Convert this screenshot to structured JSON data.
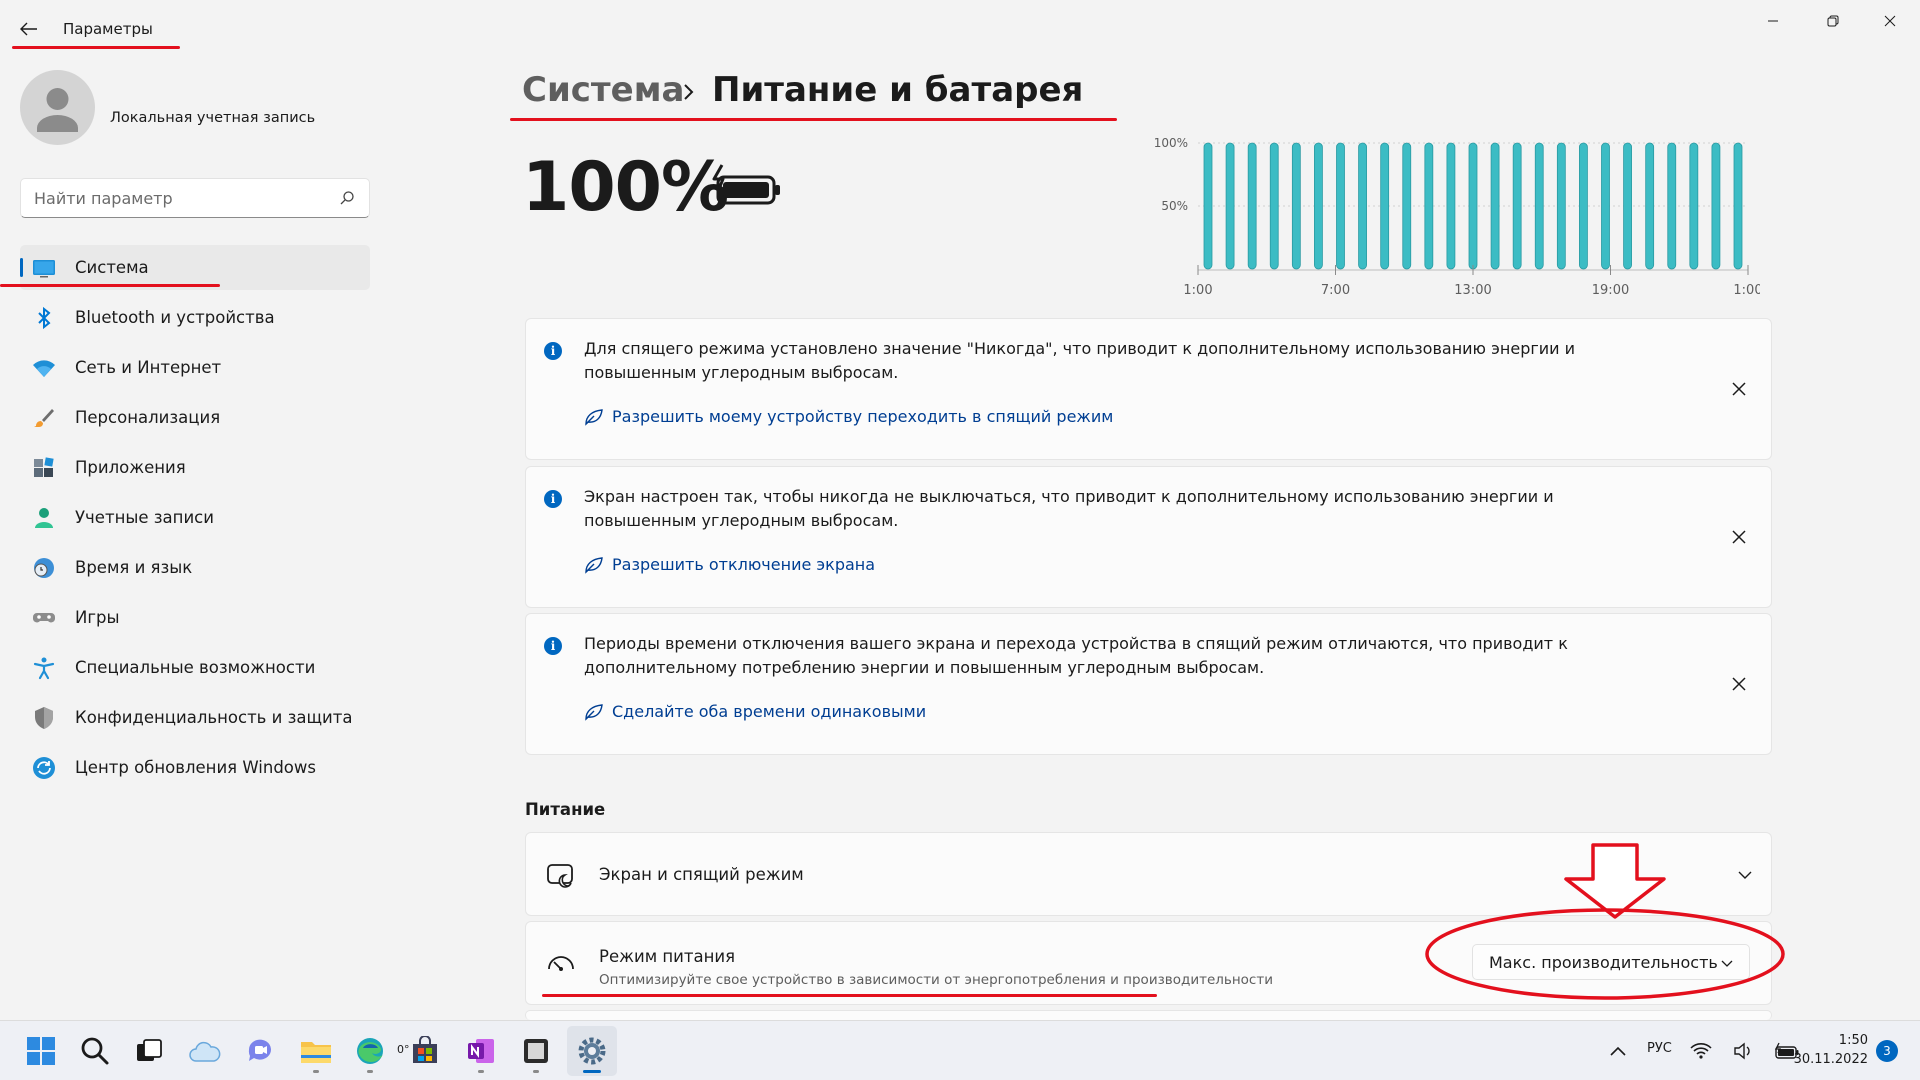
{
  "app": {
    "title": "Параметры"
  },
  "account": {
    "name": "Локальная учетная запись"
  },
  "search": {
    "placeholder": "Найти параметр"
  },
  "nav": {
    "items": [
      {
        "label": "Система",
        "icon": "system-icon"
      },
      {
        "label": "Bluetooth и устройства",
        "icon": "bluetooth-icon"
      },
      {
        "label": "Сеть и Интернет",
        "icon": "wifi-icon"
      },
      {
        "label": "Персонализация",
        "icon": "brush-icon"
      },
      {
        "label": "Приложения",
        "icon": "apps-icon"
      },
      {
        "label": "Учетные записи",
        "icon": "person-icon"
      },
      {
        "label": "Время и язык",
        "icon": "clock-globe-icon"
      },
      {
        "label": "Игры",
        "icon": "gamepad-icon"
      },
      {
        "label": "Специальные возможности",
        "icon": "accessibility-icon"
      },
      {
        "label": "Конфиденциальность и защита",
        "icon": "shield-icon"
      },
      {
        "label": "Центр обновления Windows",
        "icon": "update-icon"
      }
    ]
  },
  "breadcrumb": {
    "root": "Система",
    "separator": "›",
    "current": "Питание и батарея"
  },
  "battery": {
    "percent_text": "100%",
    "icon": "battery-charging-icon"
  },
  "usage_chart": {
    "y_labels": [
      "100%",
      "50%"
    ],
    "x_labels": [
      "1:00",
      "7:00",
      "13:00",
      "19:00",
      "1:00"
    ],
    "bar_count": 25,
    "bar_level": 1.0,
    "bar_color": "#3cbcc4"
  },
  "notices": [
    {
      "text": "Для спящего режима установлено значение \"Никогда\", что приводит к дополнительному использованию энергии и повышенным углеродным выбросам.",
      "link": "Разрешить моему устройству переходить в спящий режим"
    },
    {
      "text": "Экран настроен так, чтобы никогда не выключаться, что приводит к дополнительному использованию энергии и повышенным углеродным выбросам.",
      "link": "Разрешить отключение экрана"
    },
    {
      "text": "Периоды времени отключения вашего экрана и перехода устройства в спящий режим отличаются, что приводит к дополнительному потреблению энергии и повышенным углеродным выбросам.",
      "link": "Сделайте оба времени одинаковыми"
    }
  ],
  "power_section": {
    "title": "Питание",
    "screen_sleep": {
      "title": "Экран и спящий режим"
    },
    "power_mode": {
      "title": "Режим питания",
      "subtitle": "Оптимизируйте свое устройство в зависимости от энергопотребления и производительности",
      "value": "Макс. производительность"
    }
  },
  "taskbar": {
    "weather_temp": "0°",
    "language": "РУС",
    "time": "1:50",
    "date": "30.11.2022",
    "notification_count": "3"
  },
  "colors": {
    "accent": "#0067c0",
    "annotation_red": "#e3101d",
    "link": "#003e92"
  }
}
